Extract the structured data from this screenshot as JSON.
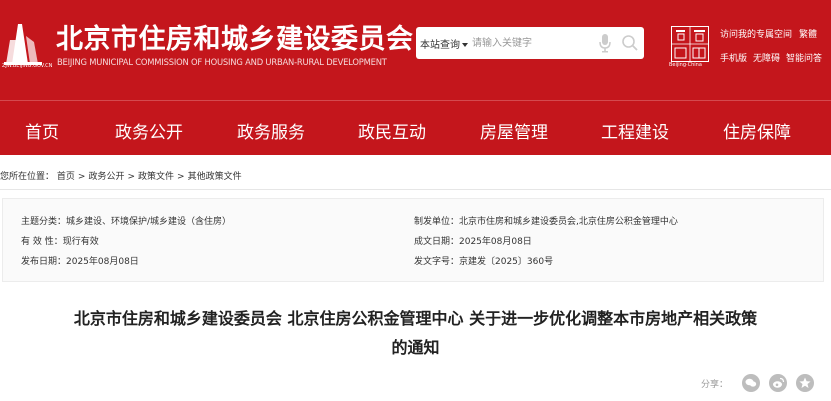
{
  "header": {
    "title": "北京市住房和城乡建设委员会",
    "subtitle": "BEIJING MUNICIPAL COMMISSION OF HOUSING AND URBAN-RURAL DEVELOPMENT",
    "domain": "ZJW.BEIJING.GOV.CN",
    "brand_color": "#c4161c",
    "search": {
      "scope": "本站查询",
      "placeholder": "请输入关键字"
    },
    "capital_logo_text": "Beijing·China",
    "top_links_row1": [
      "访问我的专属空间",
      "繁體"
    ],
    "top_links_row2": [
      "手机版",
      "无障碍",
      "智能问答"
    ]
  },
  "nav": {
    "items": [
      "首页",
      "政务公开",
      "政务服务",
      "政民互动",
      "房屋管理",
      "工程建设",
      "住房保障"
    ]
  },
  "breadcrumb": {
    "label": "您所在位置：",
    "items": [
      "首页",
      "政务公开",
      "政策文件",
      "其他政策文件"
    ],
    "separator": ">"
  },
  "meta": {
    "topic": "主题分类：城乡建设、环境保护/城乡建设（含住房）",
    "validity": "有 效 性：现行有效",
    "publish_date": "发布日期：2025年08月08日",
    "issuer": "制发单位：北京市住房和城乡建设委员会,北京住房公积金管理中心",
    "written_date": "成文日期：2025年08月08日",
    "doc_number": "发文字号：京建发〔2025〕360号"
  },
  "article": {
    "title_line1": "北京市住房和城乡建设委员会 北京住房公积金管理中心 关于进一步优化调整本市房地产相关政策",
    "title_line2": "的通知",
    "share_label": "分享："
  }
}
